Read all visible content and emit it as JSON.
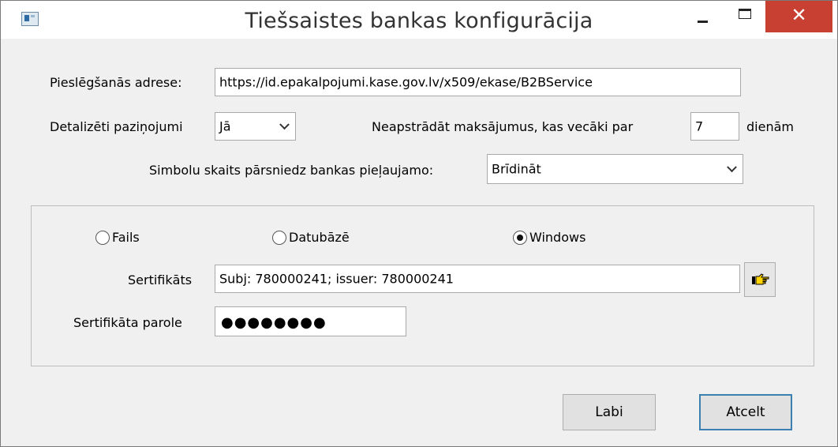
{
  "window": {
    "title": "Tiešsaistes bankas konfigurācija",
    "close_symbol": "✕"
  },
  "form": {
    "address_label": "Pieslēgšanās adrese:",
    "address_value": "https://id.epakalpojumi.kase.gov.lv/x509/ekase/B2BService",
    "detailed_label": "Detalizēti paziņojumi",
    "detailed_value": "Jā",
    "old_payments_label": "Neapstrādāt maksājumus, kas vecāki par",
    "old_payments_days": "7",
    "days_unit": "dienām",
    "symbols_label": "Simbolu skaits pārsniedz bankas pieļaujamo:",
    "symbols_value": "Brīdināt"
  },
  "certificate": {
    "source_options": [
      {
        "label": "Fails",
        "selected": false
      },
      {
        "label": "Datubāzē",
        "selected": false
      },
      {
        "label": "Windows",
        "selected": true
      }
    ],
    "cert_label": "Sertifikāts",
    "cert_value": "Subj: 780000241; issuer: 780000241",
    "password_label": "Sertifikāta parole",
    "password_mask": "●●●●●●●●"
  },
  "buttons": {
    "ok_label": "Labi",
    "cancel_label": "Atcelt"
  },
  "icons": {
    "app": "app-window-icon",
    "pick": "pointing-hand-icon"
  },
  "colors": {
    "close_button": "#c84031",
    "default_button_border": "#3c7fb1"
  }
}
